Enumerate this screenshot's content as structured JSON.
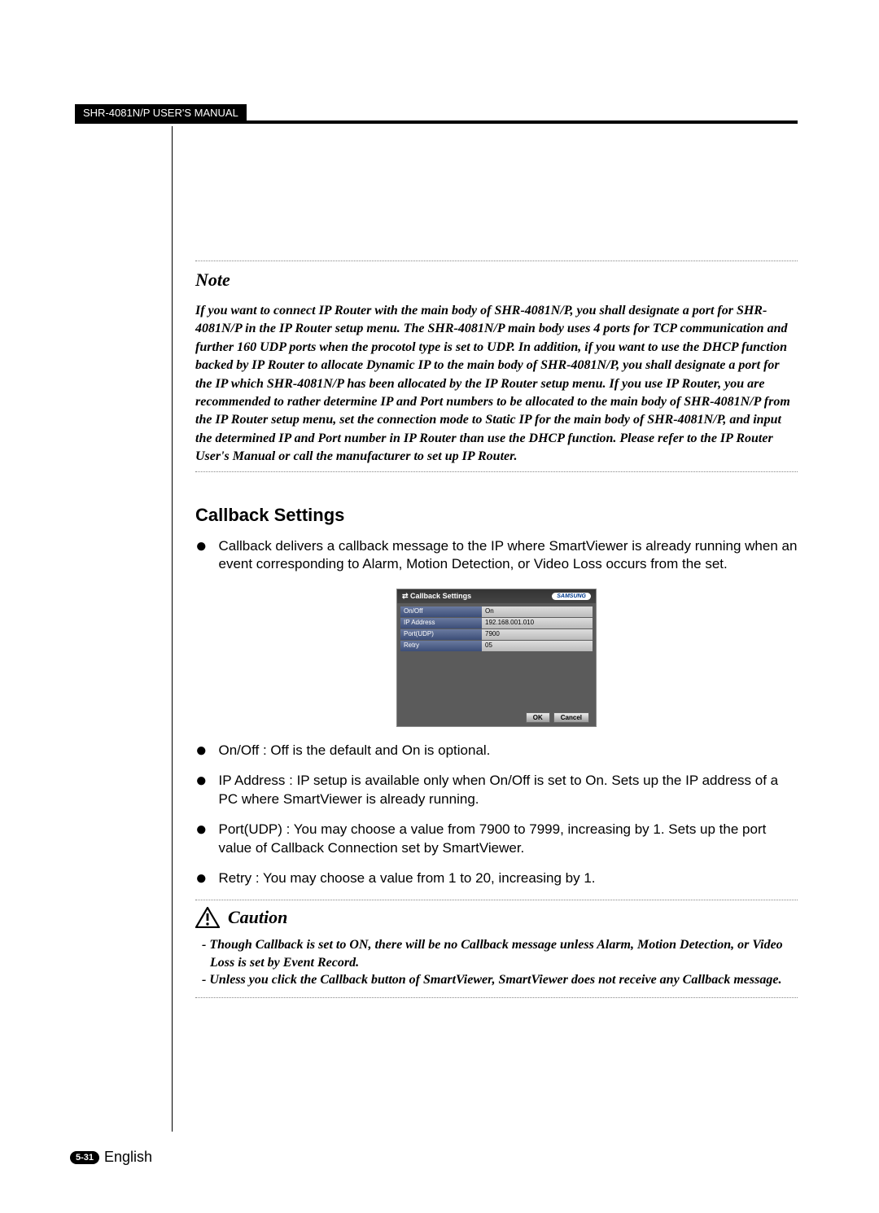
{
  "header": {
    "manual_title": "SHR-4081N/P USER'S MANUAL"
  },
  "note": {
    "title": "Note",
    "body": "If you want to connect IP Router with the main body of SHR-4081N/P, you shall designate a port for SHR-4081N/P in the IP Router setup menu. The SHR-4081N/P main body uses 4 ports for TCP communication and further 160 UDP ports when the procotol type is set to UDP. In addition, if you want to use the DHCP function backed by IP Router to allocate Dynamic IP to the main body of SHR-4081N/P, you shall designate a port for the IP which SHR-4081N/P has been allocated by the IP Router setup menu. If you use IP Router, you are recommended to rather determine IP and Port numbers to be allocated to the main body of SHR-4081N/P from the IP Router setup menu, set the connection mode to Static IP for the main body of SHR-4081N/P, and input the determined IP and Port number in IP Router than use the DHCP function. Please refer to the IP Router User's Manual or call the manufacturer to set up IP Router."
  },
  "callback": {
    "heading": "Callback Settings",
    "intro": "Callback delivers a callback message to the IP where SmartViewer is already running when an event corresponding to Alarm, Motion Detection, or Video Loss occurs from the set.",
    "dialog": {
      "title": "Callback Settings",
      "brand": "SAMSUNG",
      "labels": {
        "onoff": "On/Off",
        "ip": "IP Address",
        "port": "Port(UDP)",
        "retry": "Retry"
      },
      "values": {
        "onoff": "On",
        "ip": "192.168.001.010",
        "port": "7900",
        "retry": "05"
      },
      "ok": "OK",
      "cancel": "Cancel"
    },
    "bullets": {
      "b1": "On/Off : Off is the default and On is optional.",
      "b2": "IP Address : IP setup is available only when On/Off is set to On. Sets up the IP address of a PC where SmartViewer is already running.",
      "b3": "Port(UDP) : You may choose a value from 7900 to 7999, increasing by 1. Sets up the port value of Callback Connection set by SmartViewer.",
      "b4": "Retry : You may choose a value from 1 to 20, increasing by 1."
    }
  },
  "caution": {
    "title": "Caution",
    "items": {
      "c1": "- Though Callback is set to ON, there will be no Callback message unless Alarm, Motion Detection, or Video Loss is set by Event Record.",
      "c2": "- Unless you click the Callback button of SmartViewer, SmartViewer does not receive any Callback message."
    }
  },
  "footer": {
    "page": "5-31",
    "lang": "English"
  }
}
